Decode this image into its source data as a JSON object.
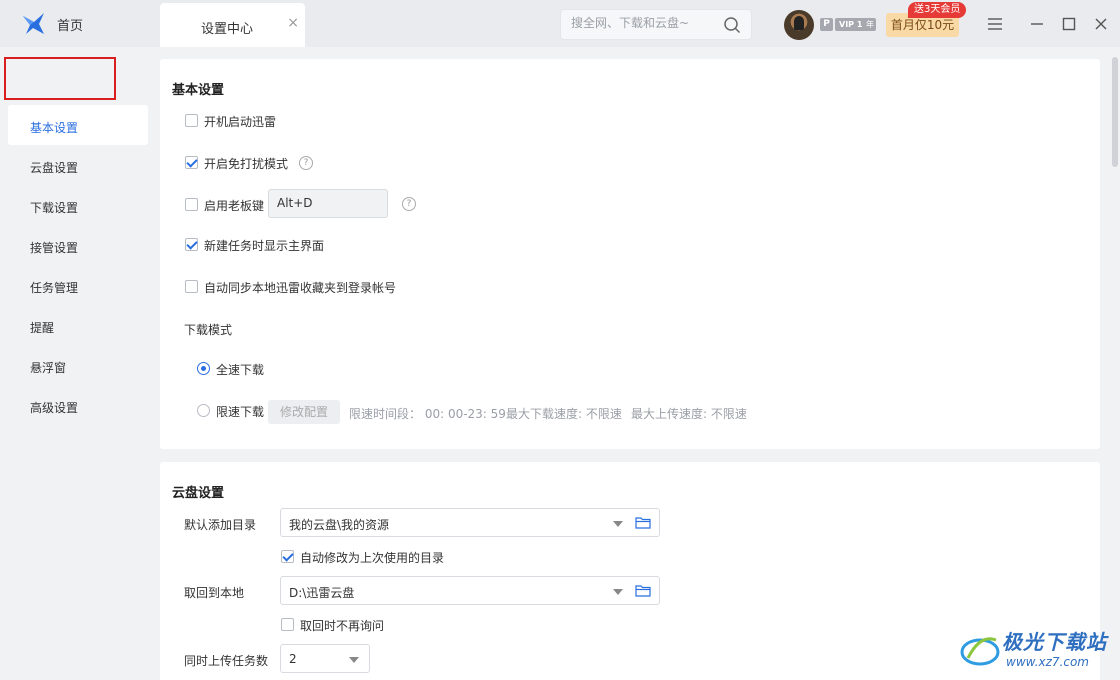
{
  "titlebar": {
    "home_label": "首页",
    "tab_label": "设置中心",
    "tab_close": "×",
    "search_placeholder": "搜全网、下载和云盘~",
    "vip_p": "P",
    "vip_level": "VIP 1",
    "vip_year": "年",
    "promo_label": "首月仅10元",
    "promo_tag": "送3天会员"
  },
  "sidebar": {
    "items": [
      {
        "label": "基本设置"
      },
      {
        "label": "云盘设置"
      },
      {
        "label": "下载设置"
      },
      {
        "label": "接管设置"
      },
      {
        "label": "任务管理"
      },
      {
        "label": "提醒"
      },
      {
        "label": "悬浮窗"
      },
      {
        "label": "高级设置"
      }
    ]
  },
  "basic": {
    "title": "基本设置",
    "autostart": {
      "label": "开机启动迅雷",
      "checked": false
    },
    "no_disturb": {
      "label": "开启免打扰模式",
      "checked": true
    },
    "boss_key": {
      "label": "启用老板键",
      "checked": false,
      "value": "Alt+D"
    },
    "show_main": {
      "label": "新建任务时显示主界面",
      "checked": true
    },
    "sync_fav": {
      "label": "自动同步本地迅雷收藏夹到登录帐号",
      "checked": false
    },
    "download_mode_title": "下载模式",
    "full_speed": {
      "label": "全速下载",
      "selected": true
    },
    "limited": {
      "label": "限速下载",
      "selected": false
    },
    "modify_btn": "修改配置",
    "limit_period": "限速时间段：  00: 00-23: 59",
    "max_down": "最大下载速度: 不限速",
    "max_up": "最大上传速度: 不限速"
  },
  "cloud": {
    "title": "云盘设置",
    "default_dir_label": "默认添加目录",
    "default_dir_value": "我的云盘\\我的资源",
    "auto_modify": {
      "label": "自动修改为上次使用的目录",
      "checked": true
    },
    "retrieve_label": "取回到本地",
    "retrieve_value": "D:\\迅雷云盘",
    "no_ask": {
      "label": "取回时不再询问",
      "checked": false
    },
    "upload_count_label": "同时上传任务数",
    "upload_count_value": "2"
  },
  "watermark": {
    "line1": "极光下载站",
    "line2": "www.xz7.com"
  },
  "colors": {
    "accent": "#2a6fe0",
    "highlight_frame": "#d81e1e",
    "promo_bg": "#f9d9a5",
    "promo_tag": "#e63a37"
  }
}
